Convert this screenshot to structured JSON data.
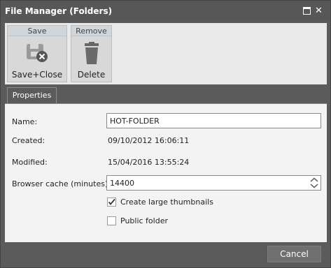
{
  "window": {
    "title": "File Manager (Folders)"
  },
  "ribbon": {
    "groups": [
      {
        "header": "Save",
        "label": "Save+Close",
        "icon": "save-close-icon"
      },
      {
        "header": "Remove",
        "label": "Delete",
        "icon": "trash-icon"
      }
    ]
  },
  "tabs": [
    {
      "label": "Properties",
      "active": true
    }
  ],
  "form": {
    "name_label": "Name:",
    "name_value": "HOT-FOLDER",
    "created_label": "Created:",
    "created_value": "09/10/2012 16:06:11",
    "modified_label": "Modified:",
    "modified_value": "15/04/2016 13:55:24",
    "cache_label": "Browser cache (minutes):",
    "cache_value": "14400",
    "thumbnails_label": "Create large thumbnails",
    "thumbnails_checked": true,
    "public_label": "Public folder",
    "public_checked": false
  },
  "footer": {
    "cancel_label": "Cancel"
  },
  "colors": {
    "chrome": "#5b5b5b",
    "panel": "#f3f3f3",
    "ribbon": "#e9e9e9"
  }
}
